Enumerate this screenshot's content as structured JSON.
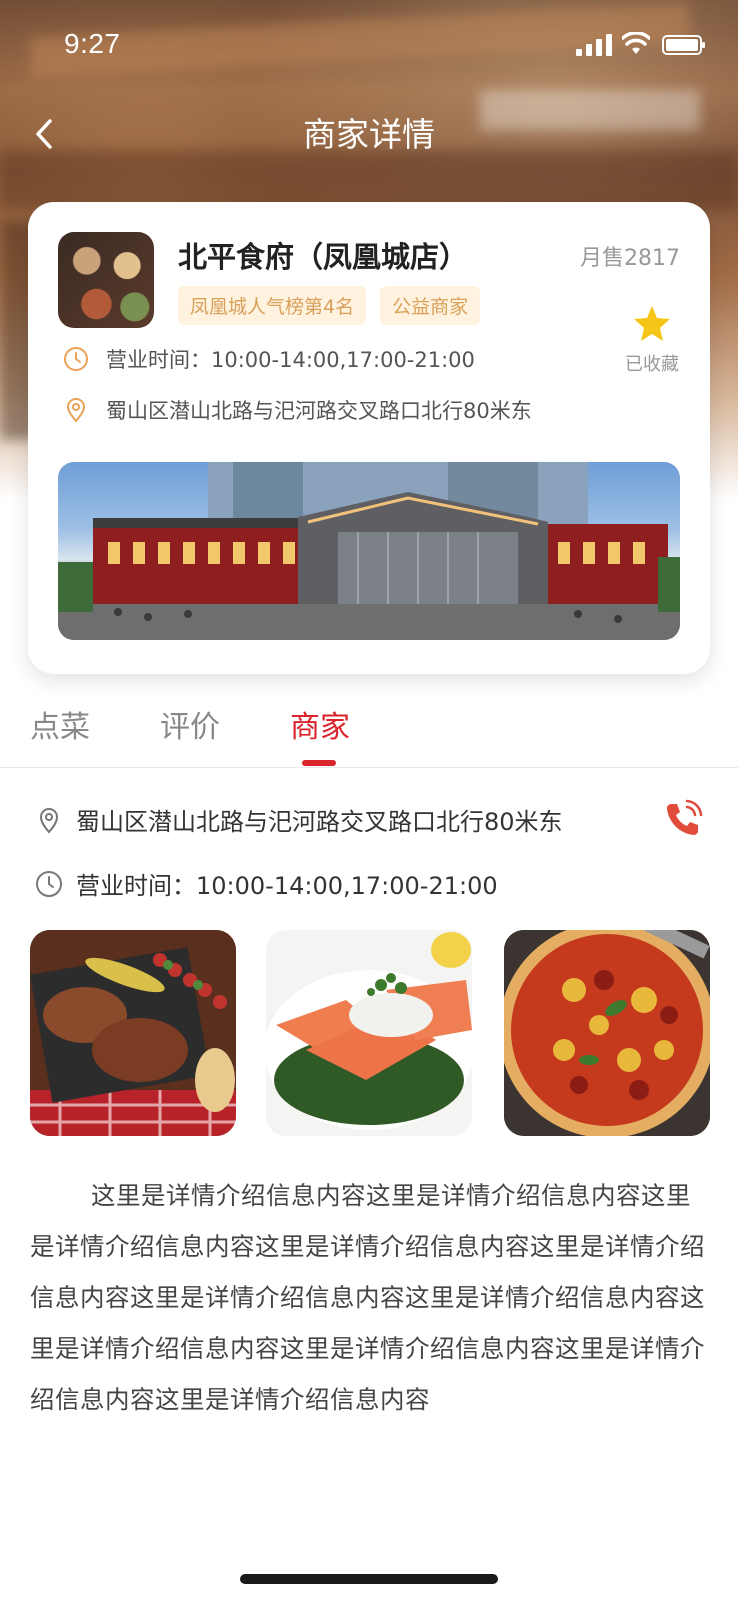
{
  "status_bar": {
    "time": "9:27"
  },
  "nav": {
    "title": "商家详情",
    "back_icon": "chevron-left-icon"
  },
  "store": {
    "name": "北平食府（凤凰城店）",
    "monthly_sales": "月售2817",
    "tags": [
      "凤凰城人气榜第4名",
      "公益商家"
    ],
    "favorite_label": "已收藏",
    "hours": "营业时间：10:00-14:00,17:00-21:00",
    "address": "蜀山区潜山北路与汜河路交叉路口北行80米东"
  },
  "tabs": [
    {
      "label": "点菜",
      "active": false
    },
    {
      "label": "评价",
      "active": false
    },
    {
      "label": "商家",
      "active": true
    }
  ],
  "merchant": {
    "address": "蜀山区潜山北路与汜河路交叉路口北行80米东",
    "hours": "营业时间：10:00-14:00,17:00-21:00",
    "description": "这里是详情介绍信息内容这里是详情介绍信息内容这里是详情介绍信息内容这里是详情介绍信息内容这里是详情介绍信息内容这里是详情介绍信息内容这里是详情介绍信息内容这里是详情介绍信息内容这里是详情介绍信息内容这里是详情介绍信息内容这里是详情介绍信息内容"
  },
  "colors": {
    "accent": "#d9242b",
    "tag_bg": "#fff3df",
    "tag_text": "#d9a05a",
    "star": "#f5c518",
    "icon_orange": "#e9a155"
  }
}
